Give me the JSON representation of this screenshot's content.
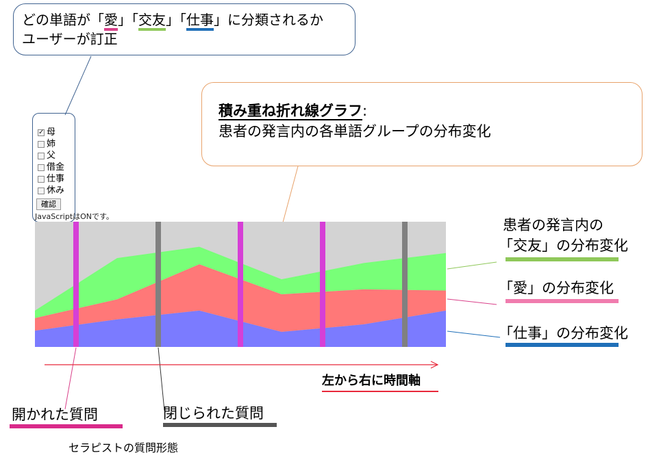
{
  "callout_user": {
    "line1_pre": "どの単語が「",
    "w_love": "愛",
    "mid1": "」「",
    "w_social": "交友",
    "mid2": "」「",
    "w_work": "仕事",
    "line1_post": "」に分類されるか",
    "line2": "ユーザーが訂正"
  },
  "callout_chart": {
    "title": "積み重ね折れ線グラフ",
    "colon": ":",
    "subtitle": "患者の発言内の各単語グループの分布変化"
  },
  "form": {
    "checkboxes": [
      {
        "label": "母",
        "checked": true
      },
      {
        "label": "姉",
        "checked": false
      },
      {
        "label": "父",
        "checked": false
      },
      {
        "label": "借金",
        "checked": false
      },
      {
        "label": "仕事",
        "checked": false
      },
      {
        "label": "休み",
        "checked": false
      }
    ],
    "confirm_label": "確認",
    "js_status": "JavaScriptはONです。"
  },
  "chart_data": {
    "type": "area",
    "stacked": true,
    "x": [
      0,
      1,
      2,
      3,
      4,
      5
    ],
    "series": [
      {
        "name": "仕事",
        "color": "#7b7bff",
        "values": [
          0.13,
          0.22,
          0.29,
          0.12,
          0.18,
          0.29
        ]
      },
      {
        "name": "愛",
        "color": "#ff7878",
        "values": [
          0.1,
          0.16,
          0.37,
          0.3,
          0.28,
          0.16
        ]
      },
      {
        "name": "交友",
        "color": "#78ff78",
        "values": [
          0.06,
          0.33,
          0.14,
          0.12,
          0.21,
          0.3
        ]
      }
    ],
    "ylim": [
      0,
      1
    ],
    "background": "#d3d3d3",
    "question_markers": [
      {
        "type": "open",
        "x": 0.5,
        "color": "#d63fd6"
      },
      {
        "type": "closed",
        "x": 1.5,
        "color": "#808080"
      },
      {
        "type": "open",
        "x": 2.5,
        "color": "#d63fd6"
      },
      {
        "type": "open",
        "x": 3.5,
        "color": "#d63fd6"
      },
      {
        "type": "closed",
        "x": 4.5,
        "color": "#808080"
      }
    ]
  },
  "labels": {
    "social_l1": "患者の発言内の",
    "social_l2": "「交友」の分布変化",
    "love": "「愛」の分布変化",
    "work": "「仕事」の分布変化",
    "time_axis": "左から右に時間軸",
    "open_q": "開かれた質問",
    "closed_q": "閉じられた質問",
    "q_form": "セラピストの質問形態"
  },
  "colors": {
    "pink": "#d9418a",
    "green": "#8fc85a",
    "blue": "#1f6fb8",
    "dark_gray": "#555555",
    "red_arrow": "#e8283a"
  }
}
